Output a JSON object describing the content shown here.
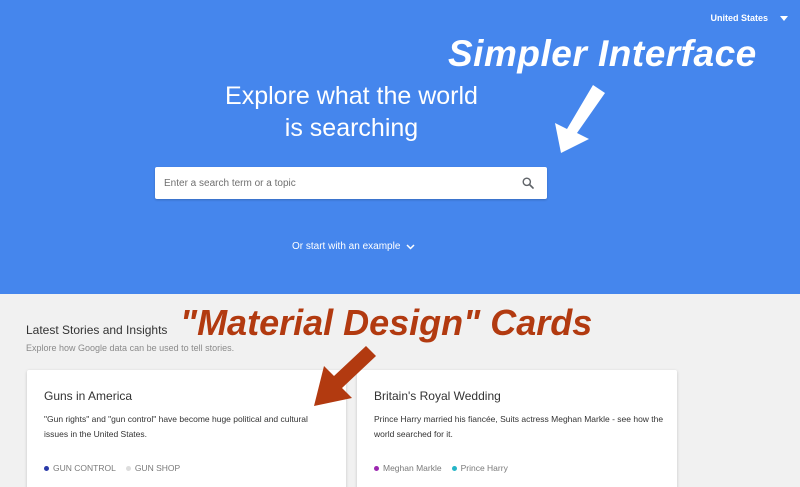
{
  "header": {
    "country": "United States"
  },
  "hero": {
    "title_line1": "Explore what the world",
    "title_line2": "is searching",
    "search_placeholder": "Enter a search term or a topic",
    "example_link": "Or start with an example"
  },
  "annotations": {
    "simpler": "Simpler Interface",
    "material": "\"Material Design\" Cards"
  },
  "stories": {
    "title": "Latest Stories and Insights",
    "subtitle": "Explore how Google data can be used to tell stories.",
    "cards": [
      {
        "title": "Guns in America",
        "description": "\"Gun rights\" and \"gun control\" have become huge political and cultural issues in the United States.",
        "tags": [
          {
            "label": "GUN CONTROL",
            "color": "#2a3aa8"
          },
          {
            "label": "GUN SHOP",
            "color": "#dddddd"
          }
        ]
      },
      {
        "title": "Britain's Royal Wedding",
        "description": "Prince Harry married his fiancée, Suits actress Meghan Markle - see how the world searched for it.",
        "tags": [
          {
            "label": "Meghan Markle",
            "color": "#9c27b0"
          },
          {
            "label": "Prince Harry",
            "color": "#26b5c7"
          }
        ]
      }
    ]
  },
  "colors": {
    "hero_bg": "#4586ed",
    "page_bg": "#f1f1f1",
    "annotation_red": "#b23a10"
  }
}
